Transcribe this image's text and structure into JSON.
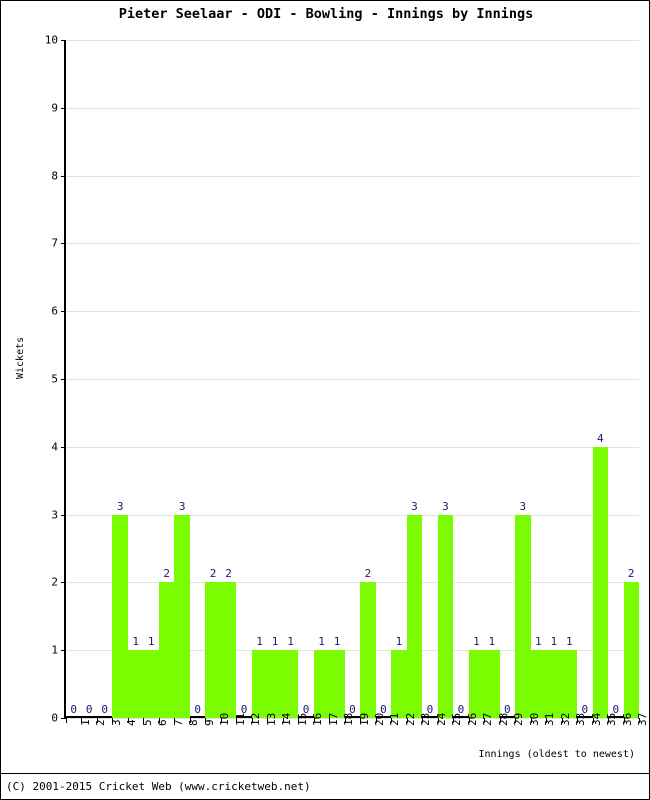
{
  "chart_data": {
    "type": "bar",
    "title": "Pieter Seelaar - ODI - Bowling - Innings by Innings",
    "xlabel": "Innings (oldest to newest)",
    "ylabel": "Wickets",
    "categories": [
      "1",
      "2",
      "3",
      "4",
      "5",
      "6",
      "7",
      "8",
      "9",
      "10",
      "11",
      "12",
      "13",
      "14",
      "15",
      "16",
      "17",
      "18",
      "19",
      "20",
      "21",
      "22",
      "23",
      "24",
      "25",
      "26",
      "27",
      "28",
      "29",
      "30",
      "31",
      "32",
      "33",
      "34",
      "35",
      "36",
      "37"
    ],
    "values": [
      0,
      0,
      0,
      3,
      1,
      1,
      2,
      3,
      0,
      2,
      2,
      0,
      1,
      1,
      1,
      0,
      1,
      1,
      0,
      2,
      0,
      1,
      3,
      0,
      3,
      0,
      1,
      1,
      0,
      3,
      1,
      1,
      1,
      0,
      4,
      0,
      2
    ],
    "data_labels": [
      "0",
      "0",
      "0",
      "3",
      "1",
      "1",
      "2",
      "3",
      "0",
      "2",
      "2",
      "0",
      "1",
      "1",
      "1",
      "0",
      "1",
      "1",
      "0",
      "2",
      "0",
      "1",
      "3",
      "0",
      "3",
      "0",
      "1",
      "1",
      "0",
      "3",
      "1",
      "1",
      "1",
      "0",
      "4",
      "0",
      "2"
    ],
    "ylim": [
      0,
      10
    ],
    "yticks": [
      0,
      1,
      2,
      3,
      4,
      5,
      6,
      7,
      8,
      9,
      10
    ],
    "ytick_labels": [
      "0",
      "1",
      "2",
      "3",
      "4",
      "5",
      "6",
      "7",
      "8",
      "9",
      "10"
    ],
    "grid": true,
    "legend": null,
    "series_color": "#7cfc00",
    "label_color": "#1a1a70",
    "gridline_color": "#e3e3e3",
    "axis_color": "#000000"
  },
  "footer": {
    "copyright": "(C) 2001-2015 Cricket Web (www.cricketweb.net)"
  }
}
